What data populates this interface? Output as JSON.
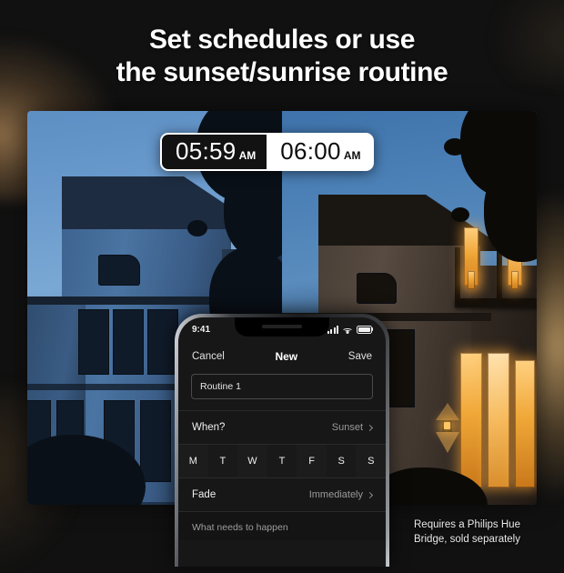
{
  "headline": {
    "line1": "Set schedules or use",
    "line2": "the sunset/sunrise routine"
  },
  "time_badges": {
    "before": {
      "time": "05:59",
      "meridiem": "AM"
    },
    "after": {
      "time": "06:00",
      "meridiem": "AM"
    }
  },
  "phone": {
    "status_bar": {
      "time": "9:41",
      "icons": [
        "signal-icon",
        "wifi-icon",
        "battery-icon"
      ]
    },
    "nav": {
      "cancel": "Cancel",
      "title": "New",
      "save": "Save"
    },
    "name_field": {
      "value": "Routine 1"
    },
    "when_row": {
      "label": "When?",
      "value": "Sunset"
    },
    "days": [
      "M",
      "T",
      "W",
      "T",
      "F",
      "S",
      "S"
    ],
    "fade_row": {
      "label": "Fade",
      "value": "Immediately"
    },
    "section_header": "What needs to happen"
  },
  "caption": {
    "line1": "Requires a Philips Hue",
    "line2": "Bridge, sold separately"
  },
  "colors": {
    "background": "#111111",
    "headline_text": "#ffffff",
    "badge_dark_bg": "#121212",
    "badge_light_bg": "#ffffff",
    "warm_glow": "#d6ad70",
    "lit_window": "#f0a838",
    "night_blue": "#4a74a2"
  }
}
